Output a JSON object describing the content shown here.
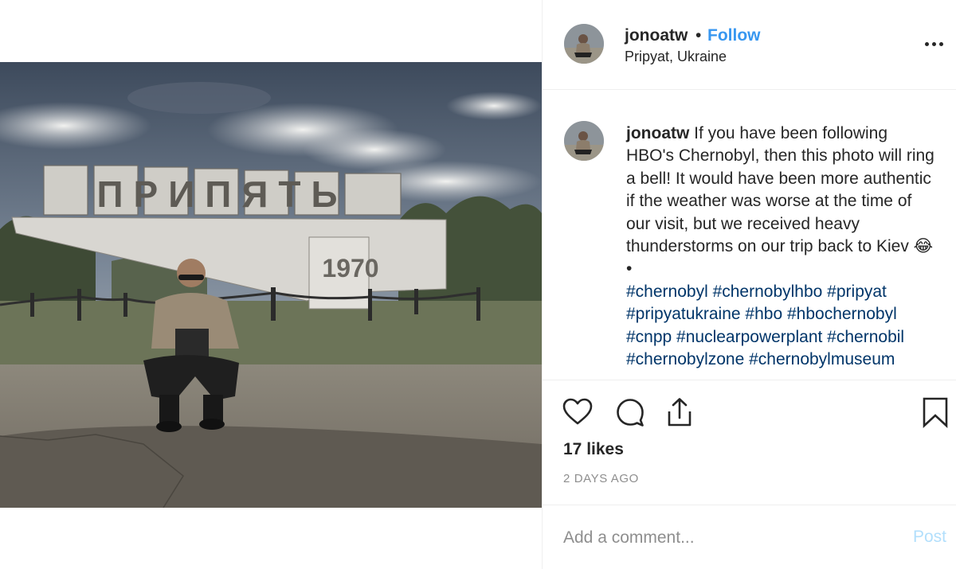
{
  "post": {
    "username": "jonoatw",
    "separator": "•",
    "follow_label": "Follow",
    "location": "Pripyat, Ukraine",
    "sign_text": "ПРИПЯТЬ",
    "sign_year": "1970"
  },
  "caption": {
    "username": "jonoatw",
    "text": "If you have been following HBO's Chernobyl, then this photo will ring a bell! It would have been more authentic if the weather was worse at the time of our visit, but we received heavy thunderstorms on our trip back to Kiev 😂",
    "bullet": "•",
    "hashtags": "#chernobyl #chernobylhbo #pripyat #pripyatukraine #hbo #hbochernobyl #cnpp #nuclearpowerplant #chernobil #chernobylzone #chernobylmuseum"
  },
  "actions": {
    "like_icon": "heart-icon",
    "comment_icon": "comment-icon",
    "share_icon": "share-icon",
    "save_icon": "bookmark-icon"
  },
  "stats": {
    "likes": "17 likes",
    "posted": "2 DAYS AGO"
  },
  "comment": {
    "placeholder": "Add a comment...",
    "post_label": "Post"
  },
  "colors": {
    "link": "#3897f0",
    "hashtag": "#003569",
    "muted": "#8e8e8e",
    "post_disabled": "#b2dffc"
  }
}
